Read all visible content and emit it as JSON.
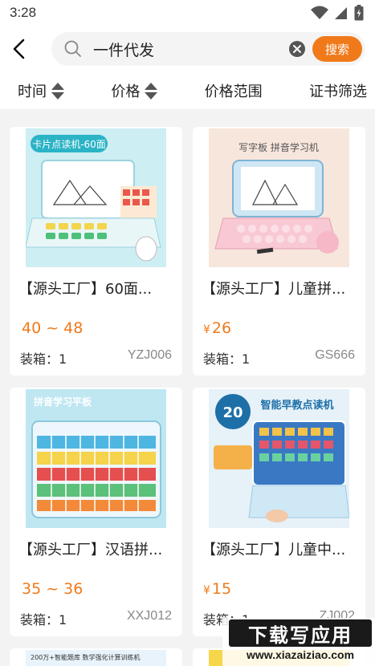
{
  "status_bar": {
    "time": "3:28"
  },
  "search": {
    "query": "一件代发",
    "button_label": "搜索"
  },
  "filters": [
    {
      "label": "时间"
    },
    {
      "label": "价格"
    },
    {
      "label": "价格范围"
    },
    {
      "label": "证书筛选"
    }
  ],
  "products": [
    {
      "title": "【源头工厂】60面...",
      "price": "40 ~ 48",
      "currency": "",
      "box_label": "装箱：1",
      "code": "YZJ006",
      "image_caption": "卡片点读机-60面"
    },
    {
      "title": "【源头工厂】儿童拼...",
      "price": "26",
      "currency": "¥",
      "box_label": "装箱：1",
      "code": "GS666",
      "image_caption": "写字板 拼音学习机"
    },
    {
      "title": "【源头工厂】汉语拼...",
      "price": "35 ~ 36",
      "currency": "",
      "box_label": "装箱：1",
      "code": "XXJ012",
      "image_caption": "拼音学习平板"
    },
    {
      "title": "【源头工厂】儿童中...",
      "price": "15",
      "currency": "¥",
      "box_label": "装箱：1",
      "code": "ZJ002",
      "image_caption": "智能早教点读机"
    }
  ],
  "partial_cards": [
    {
      "caption": "200万+智能题库 数学强化计算训练机"
    },
    {
      "caption": ""
    }
  ],
  "watermark": {
    "top": "下载写应用",
    "bottom": "www.xiazaiziao.com"
  },
  "colors": {
    "accent": "#f07a1a",
    "background": "#f3f3f3"
  }
}
